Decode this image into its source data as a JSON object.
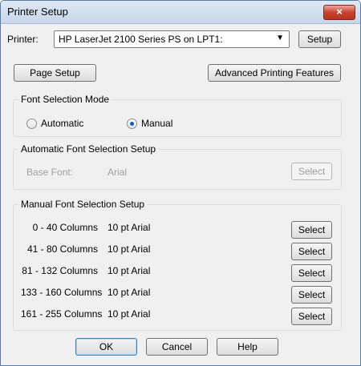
{
  "window": {
    "title": "Printer Setup",
    "close_icon": "×"
  },
  "printer": {
    "label": "Printer:",
    "selected": "HP LaserJet 2100 Series PS on LPT1:",
    "setup_button": "Setup"
  },
  "buttons": {
    "page_setup": "Page Setup",
    "advanced": "Advanced Printing Features",
    "ok": "OK",
    "cancel": "Cancel",
    "help": "Help"
  },
  "font_selection_mode": {
    "title": "Font Selection Mode",
    "automatic": "Automatic",
    "manual": "Manual",
    "selected": "Manual"
  },
  "automatic_setup": {
    "title": "Automatic Font Selection Setup",
    "base_font_label": "Base Font:",
    "base_font_value": "Arial",
    "select_button": "Select"
  },
  "manual_setup": {
    "title": "Manual Font Selection Setup",
    "rows": [
      {
        "columns": "0 - 40 Columns",
        "font": "10 pt Arial",
        "button": "Select"
      },
      {
        "columns": "41 - 80 Columns",
        "font": "10 pt Arial",
        "button": "Select"
      },
      {
        "columns": "81 - 132 Columns",
        "font": "10 pt Arial",
        "button": "Select"
      },
      {
        "columns": "133 - 160 Columns",
        "font": "10 pt Arial",
        "button": "Select"
      },
      {
        "columns": "161 - 255 Columns",
        "font": "10 pt Arial",
        "button": "Select"
      }
    ]
  }
}
